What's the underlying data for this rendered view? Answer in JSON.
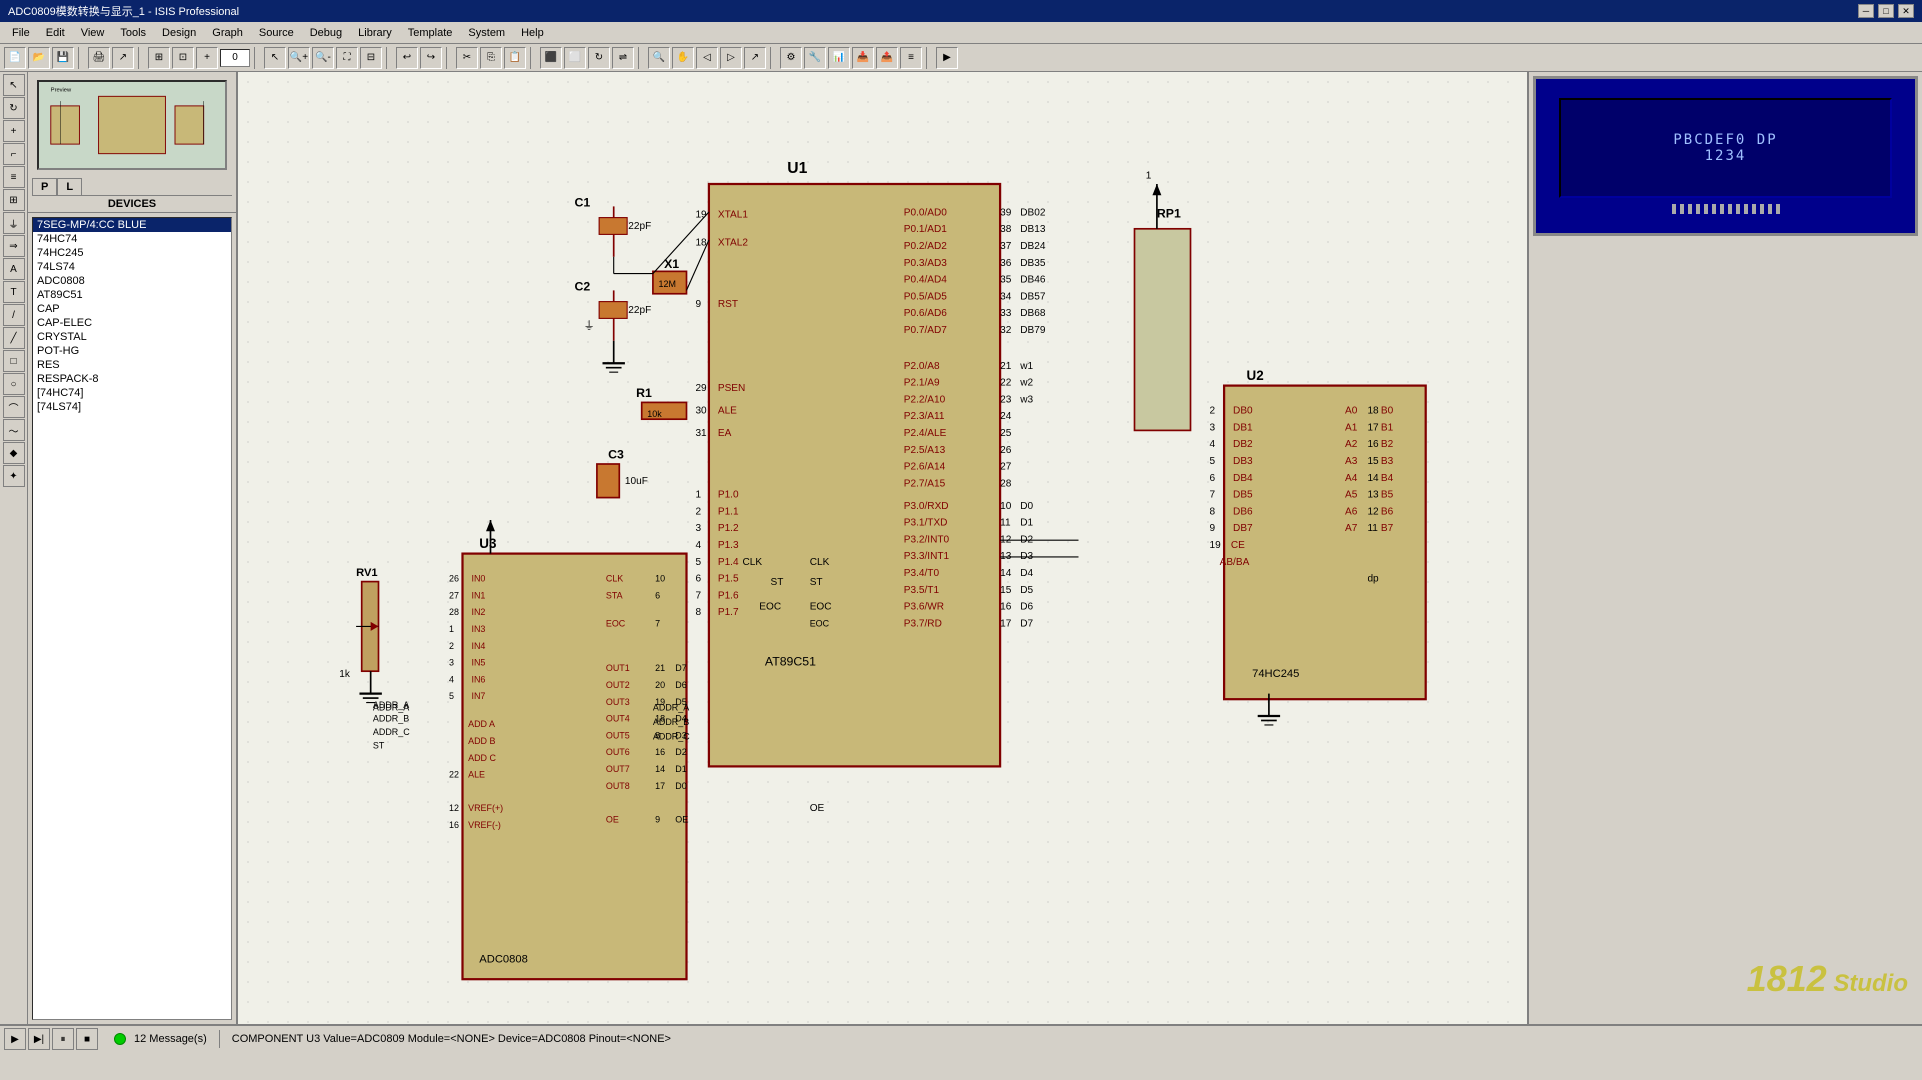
{
  "titlebar": {
    "title": "ADC0809模数转换与显示_1 - ISIS Professional",
    "min_label": "─",
    "max_label": "□",
    "close_label": "✕"
  },
  "menubar": {
    "items": [
      "File",
      "Edit",
      "View",
      "Tools",
      "Design",
      "Graph",
      "Source",
      "Debug",
      "Library",
      "Template",
      "System",
      "Help"
    ]
  },
  "toolbar1": {
    "input_value": "0"
  },
  "sidebar": {
    "tabs": [
      {
        "label": "P",
        "id": "p-tab"
      },
      {
        "label": "L",
        "id": "l-tab"
      }
    ],
    "devices_label": "DEVICES",
    "device_list": [
      "7SEG-MP/4:CC BLUE",
      "74HC74",
      "74HC245",
      "74LS74",
      "ADC0808",
      "AT89C51",
      "CAP",
      "CAP-ELEC",
      "CRYSTAL",
      "POT-HG",
      "RES",
      "RESPACK-8",
      "[74HC74]",
      "[74LS74]"
    ],
    "selected_device": "7SEG-MP/4:CC BLUE"
  },
  "lcd": {
    "row1": "PBCDEF0 DP",
    "row2": "1234",
    "bg_color": "#00008b"
  },
  "watermark": {
    "text": "1812 Studio"
  },
  "statusbar": {
    "message_count": "12 Message(s)",
    "component_info": "COMPONENT U3  Value=ADC0809 Module=<NONE>  Device=ADC0808 Pinout=<NONE>"
  },
  "schematic": {
    "components": [
      {
        "id": "C1",
        "label": "C1",
        "value": "22pF"
      },
      {
        "id": "C2",
        "label": "C2",
        "value": "22pF"
      },
      {
        "id": "C3",
        "label": "C3",
        "value": "10uF"
      },
      {
        "id": "X1",
        "label": "X1",
        "value": "12M"
      },
      {
        "id": "R1",
        "label": "R1",
        "value": "10k"
      },
      {
        "id": "U1",
        "label": "U1",
        "value": "AT89C51"
      },
      {
        "id": "U2",
        "label": "U2",
        "value": "74HC245"
      },
      {
        "id": "U3",
        "label": "U3",
        "value": "ADC0808"
      },
      {
        "id": "RP1",
        "label": "RP1"
      },
      {
        "id": "RV1",
        "label": "RV1"
      },
      {
        "id": "7SEG",
        "label": "7SEG display"
      }
    ]
  },
  "playback": {
    "play_label": "▶",
    "step_label": "▶|",
    "pause_label": "⏸",
    "stop_label": "■"
  }
}
